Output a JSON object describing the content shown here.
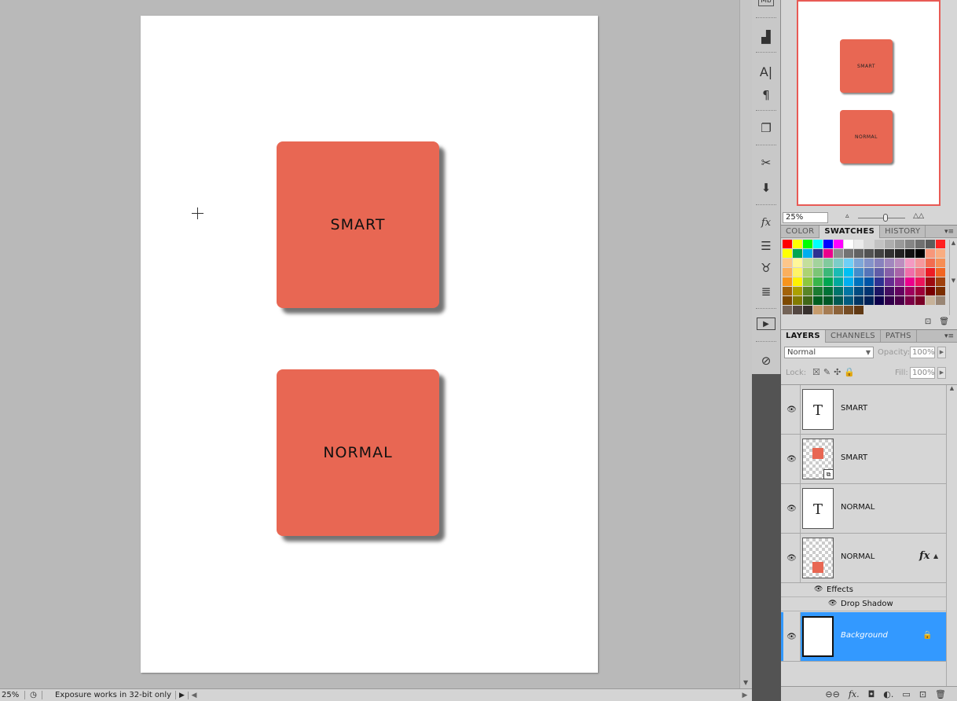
{
  "document": {
    "cards": [
      {
        "label": "SMART"
      },
      {
        "label": "NORMAL"
      }
    ]
  },
  "status_bar": {
    "zoom": "25%",
    "message": "Exposure works in 32-bit only"
  },
  "navigator": {
    "zoom": "25%",
    "preview_labels": [
      "SMART",
      "NORMAL"
    ],
    "frame_color": "#e85a55"
  },
  "color_panel": {
    "tabs": [
      {
        "label": "COLOR"
      },
      {
        "label": "SWATCHES"
      },
      {
        "label": "HISTORY"
      }
    ],
    "active_tab": "SWATCHES"
  },
  "swatch_colors": [
    "#ff0000",
    "#ffff00",
    "#00ff00",
    "#00ffff",
    "#0000ff",
    "#ff00ff",
    "#ffffff",
    "#ebebeb",
    "#d6d6d6",
    "#c2c2c2",
    "#adadad",
    "#999999",
    "#858585",
    "#707070",
    "#5c5c5c",
    "#ff2020",
    "#ffff00",
    "#00a651",
    "#00aeef",
    "#2e3192",
    "#ec008c",
    "#8c8c8c",
    "#737373",
    "#626262",
    "#525252",
    "#424242",
    "#313131",
    "#212121",
    "#111111",
    "#000000",
    "#f7977a",
    "#f9ad81",
    "#fdc68a",
    "#fff79a",
    "#c4df9b",
    "#a3d39c",
    "#82ca9d",
    "#7bcdc8",
    "#6ecff6",
    "#7ea7d8",
    "#8493ca",
    "#8882be",
    "#a187be",
    "#bc8dbf",
    "#f49ac2",
    "#f6989d",
    "#f26c4f",
    "#f68e55",
    "#fbaf5d",
    "#fff467",
    "#acd372",
    "#7cc576",
    "#3bb878",
    "#1abbb4",
    "#00bff3",
    "#438ccb",
    "#5574b9",
    "#605ca8",
    "#855fa8",
    "#a763a8",
    "#f06ea9",
    "#f26d7d",
    "#ed1c24",
    "#f26522",
    "#f7941d",
    "#fff200",
    "#8dc73f",
    "#39b54a",
    "#00a651",
    "#00a99d",
    "#00aeef",
    "#0072bc",
    "#0054a6",
    "#2e3192",
    "#662d91",
    "#92278f",
    "#ec008c",
    "#ed145b",
    "#9e0b0f",
    "#a0410d",
    "#a36209",
    "#aba000",
    "#598527",
    "#1a7b30",
    "#007236",
    "#00746b",
    "#0076a3",
    "#004b80",
    "#003471",
    "#1b1464",
    "#440e62",
    "#630460",
    "#9e005d",
    "#9e0039",
    "#790000",
    "#7b2e00",
    "#7d4900",
    "#827b00",
    "#406618",
    "#005e20",
    "#005826",
    "#005952",
    "#005b7f",
    "#003663",
    "#002157",
    "#0d004c",
    "#32004b",
    "#4b0049",
    "#7b0046",
    "#7a0026",
    "#c7b299",
    "#998675",
    "#736357",
    "#534741",
    "#37302d",
    "#c69c6d",
    "#a67c52",
    "#8c6239",
    "#754c24",
    "#603913"
  ],
  "layers_panel": {
    "tabs": [
      {
        "label": "LAYERS"
      },
      {
        "label": "CHANNELS"
      },
      {
        "label": "PATHS"
      }
    ],
    "blend_mode": "Normal",
    "opacity_label": "Opacity:",
    "opacity": "100%",
    "lock_label": "Lock:",
    "fill_label": "Fill:",
    "fill": "100%",
    "layers": [
      {
        "name": "SMART",
        "kind": "text"
      },
      {
        "name": "SMART",
        "kind": "smart-object"
      },
      {
        "name": "NORMAL",
        "kind": "text"
      },
      {
        "name": "NORMAL",
        "kind": "pixel",
        "fx": "fx"
      },
      {
        "name": "Background",
        "kind": "background",
        "selected": true
      }
    ],
    "effects_label": "Effects",
    "drop_shadow_label": "Drop Shadow"
  },
  "colors": {
    "card": "#e86753",
    "selection": "#3399ff"
  }
}
